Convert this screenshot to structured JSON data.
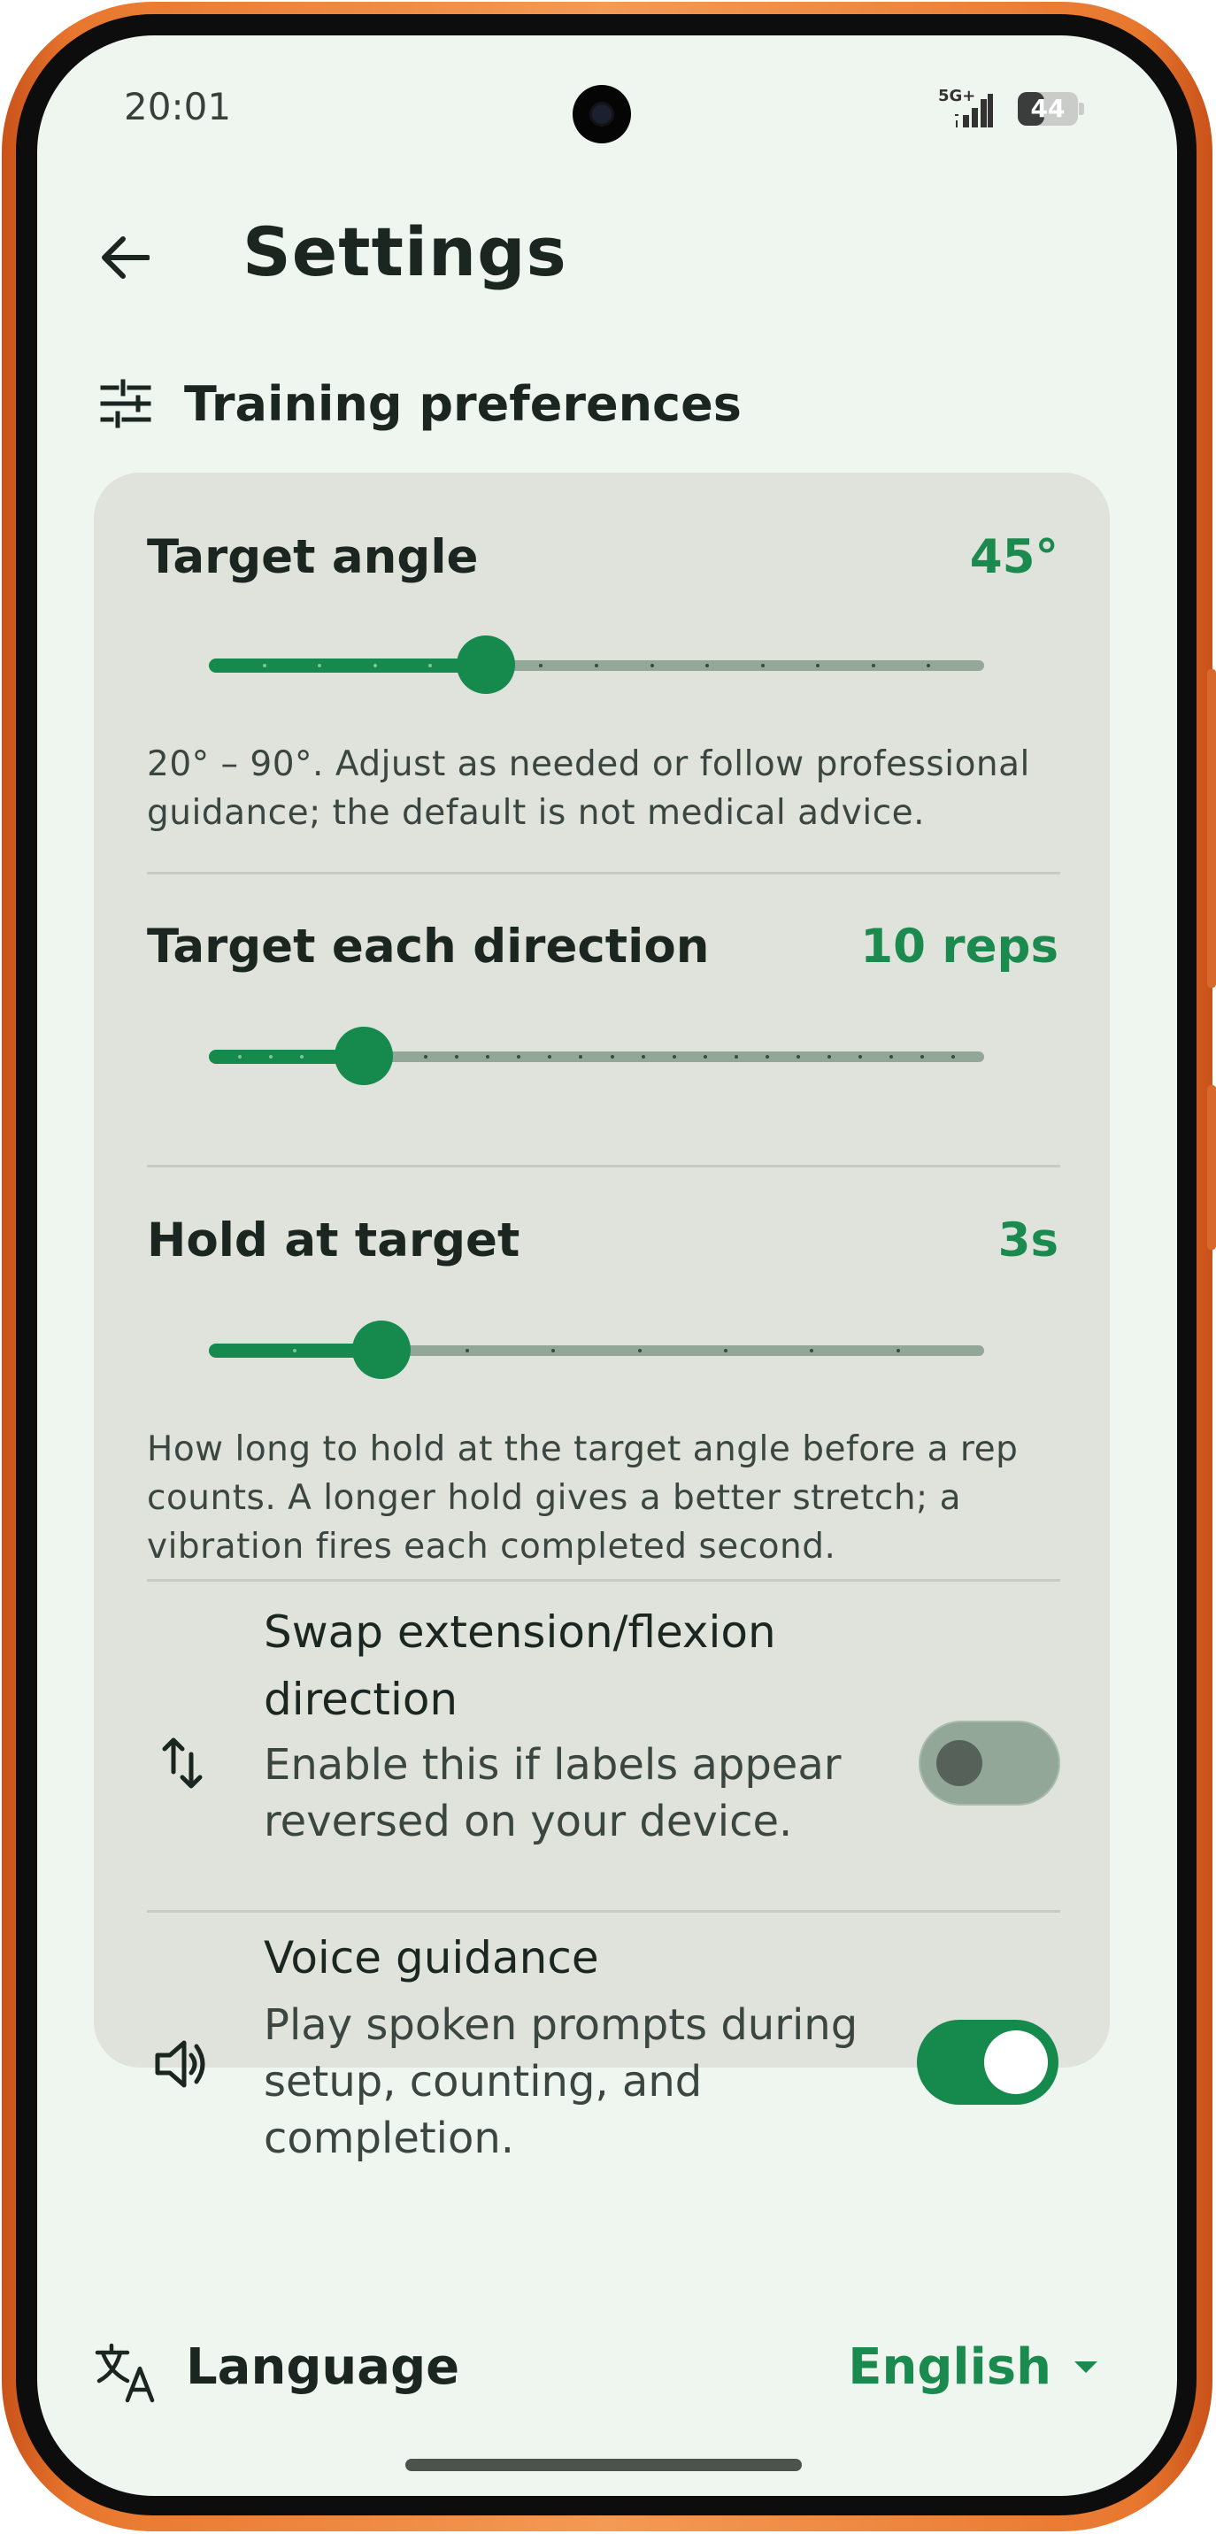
{
  "status_bar": {
    "time": "20:01",
    "network": "5G+",
    "battery_level": "44",
    "battery_fraction": 0.44
  },
  "header": {
    "title": "Settings"
  },
  "training_section": {
    "title": "Training preferences"
  },
  "target_angle": {
    "label": "Target angle",
    "value_text": "45°",
    "value": 45,
    "min": 20,
    "max": 90,
    "step": 5,
    "help": "20° – 90°. Adjust as needed or follow professional guidance; the default is not medical advice."
  },
  "target_reps": {
    "label": "Target each direction",
    "value_text": "10 reps",
    "value": 10,
    "min": 5,
    "max": 30,
    "step": 1
  },
  "hold": {
    "label": "Hold at target",
    "value_text": "3s",
    "value": 3,
    "min": 1,
    "max": 10,
    "step": 1,
    "help": "How long to hold at the target angle before a rep counts. A longer hold gives a better stretch; a vibration fires each completed second."
  },
  "swap_direction": {
    "title": "Swap extension/flexion direction",
    "description": "Enable this if labels appear reversed on your device.",
    "enabled": false
  },
  "voice_guidance": {
    "title": "Voice guidance",
    "description": "Play spoken prompts during setup, counting, and completion.",
    "enabled": true
  },
  "language": {
    "label": "Language",
    "value": "English"
  },
  "colors": {
    "accent": "#158a4c",
    "background": "#eff5ef",
    "card": "#e0e2dc",
    "frame": "#e8772e"
  },
  "icons": {
    "back": "arrow-left-icon",
    "section": "tune-icon",
    "swap": "swap-vertical-icon",
    "voice": "speaker-icon",
    "language": "translate-icon",
    "dropdown": "caret-down-icon"
  }
}
